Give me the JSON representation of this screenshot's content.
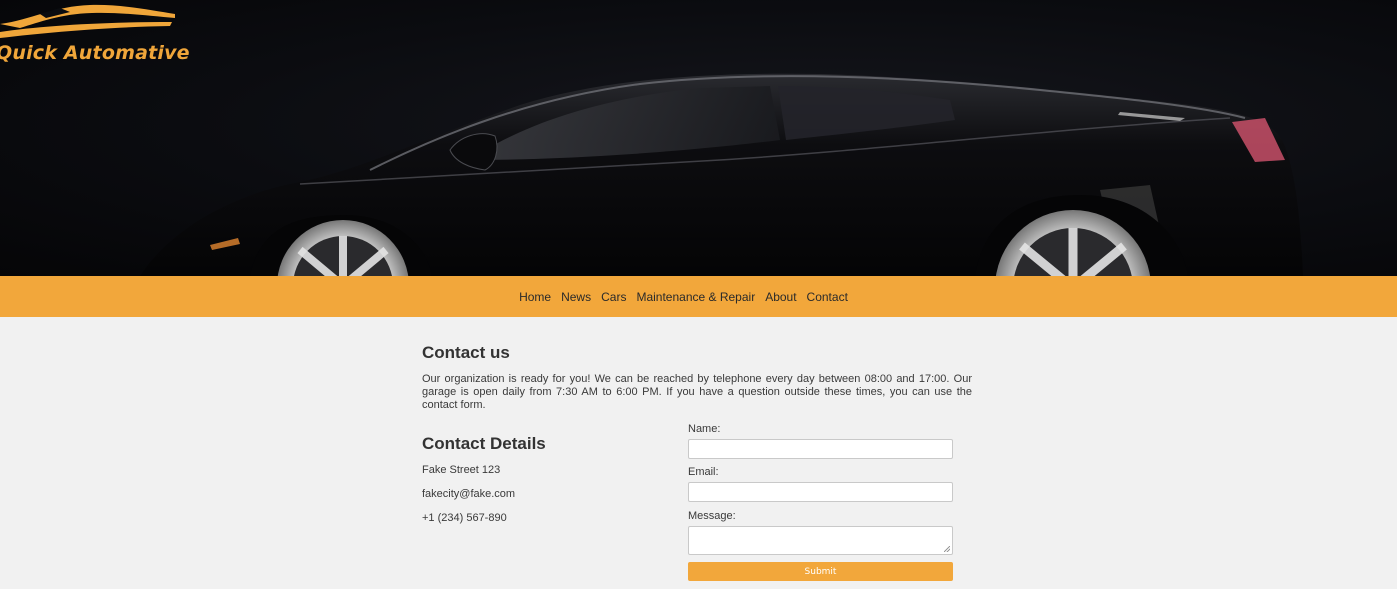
{
  "brand": {
    "name": "Quick Automative",
    "logo_icon": "car-silhouette-icon",
    "accent_color": "#f2a73b"
  },
  "hero": {
    "image": "black-sports-car"
  },
  "nav": {
    "items": [
      {
        "label": "Home"
      },
      {
        "label": "News"
      },
      {
        "label": "Cars"
      },
      {
        "label": "Maintenance & Repair"
      },
      {
        "label": "About"
      },
      {
        "label": "Contact"
      }
    ]
  },
  "contact": {
    "title": "Contact us",
    "intro": "Our organization is ready for you! We can be reached by telephone every day between 08:00 and 17:00. Our garage is open daily from 7:30 AM to 6:00 PM. If you have a question outside these times, you can use the contact form.",
    "details": {
      "title": "Contact Details",
      "address": "Fake Street 123",
      "email": "fakecity@fake.com",
      "phone": "+1 (234) 567-890"
    },
    "form": {
      "name_label": "Name:",
      "name_value": "",
      "email_label": "Email:",
      "email_value": "",
      "message_label": "Message:",
      "message_value": "",
      "submit_label": "Submit"
    }
  }
}
